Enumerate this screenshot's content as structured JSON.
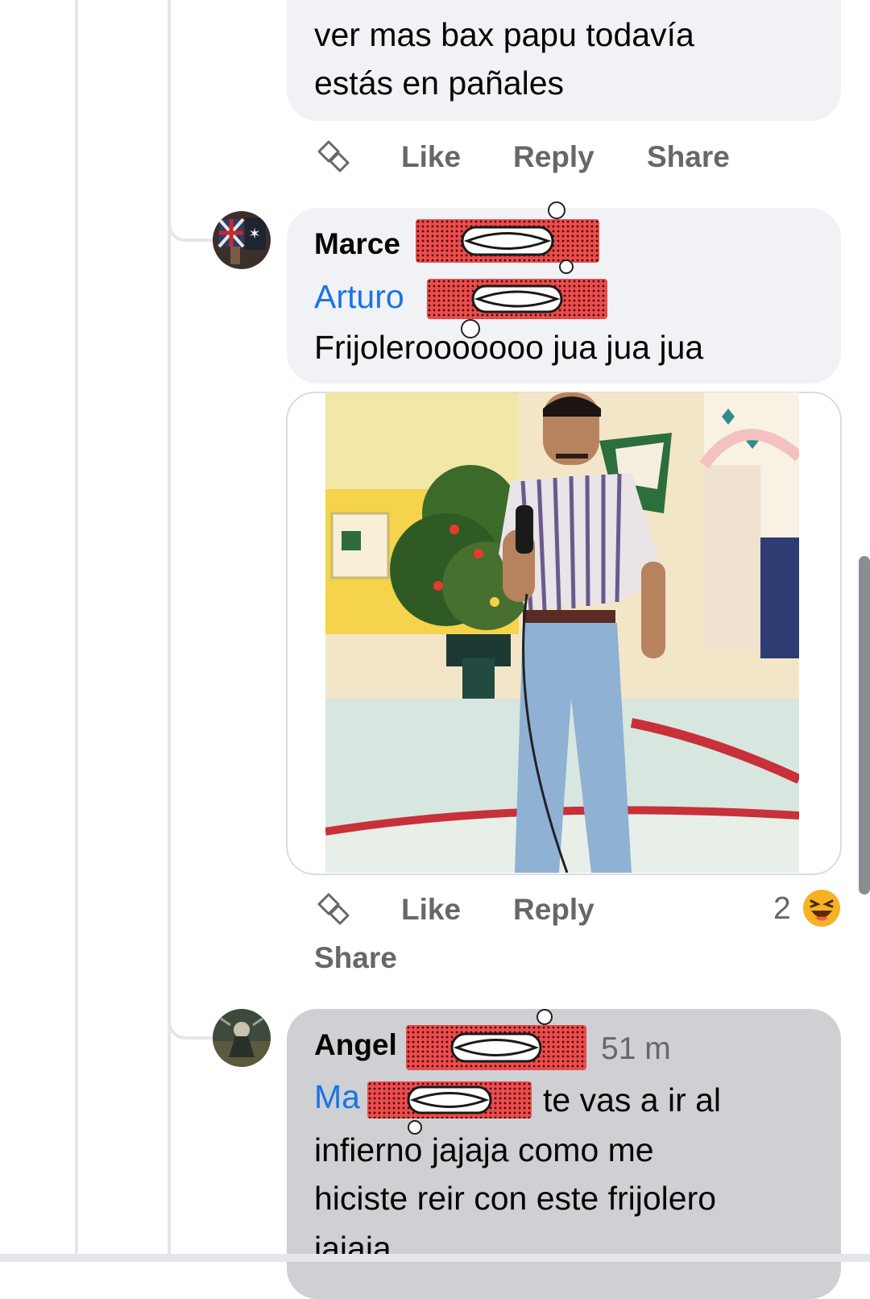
{
  "comment1": {
    "text_line1": "ver mas bax papu todavía",
    "text_line2": "estás en pañales",
    "actions": {
      "like": "Like",
      "reply": "Reply",
      "share": "Share"
    }
  },
  "comment2": {
    "author": "Marce",
    "mention": "Arturo",
    "text": "Frijolerooooooo jua jua jua",
    "actions": {
      "like": "Like",
      "reply": "Reply",
      "share": "Share"
    },
    "reaction_count": "2",
    "reaction_type": "haha"
  },
  "comment3": {
    "author": "Angel",
    "time": "51 m",
    "mention": "Ma",
    "text_line1": "te vas a ir al",
    "text_line2": "infierno jajaja como me",
    "text_line3": "hiciste reir con este frijolero",
    "text_line4": "jajaja"
  },
  "colors": {
    "bubble": "#f0f2f5",
    "bubble_highlight": "#ced0d4",
    "mention": "#1b74e4",
    "secondary_text": "#65676b",
    "redaction": "#ef4b4b",
    "haha_reaction": "#f7b125"
  },
  "icons": {
    "translate": "translate-icon",
    "haha": "haha-reaction-icon"
  }
}
